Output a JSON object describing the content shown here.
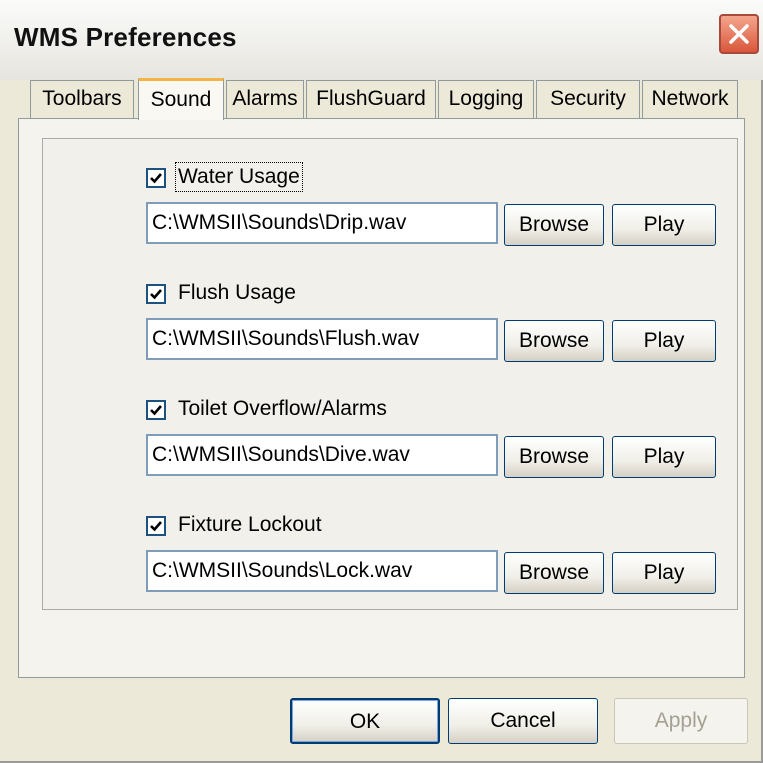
{
  "window": {
    "title": "WMS Preferences"
  },
  "tabs": [
    {
      "label": "Toolbars"
    },
    {
      "label": "Sound",
      "active": true
    },
    {
      "label": "Alarms"
    },
    {
      "label": "FlushGuard"
    },
    {
      "label": "Logging"
    },
    {
      "label": "Security"
    },
    {
      "label": "Network"
    }
  ],
  "sounds": [
    {
      "label": "Water Usage",
      "checked": true,
      "path": "C:\\WMSII\\Sounds\\Drip.wav",
      "browse": "Browse",
      "play": "Play"
    },
    {
      "label": "Flush Usage",
      "checked": true,
      "path": "C:\\WMSII\\Sounds\\Flush.wav",
      "browse": "Browse",
      "play": "Play"
    },
    {
      "label": "Toilet Overflow/Alarms",
      "checked": true,
      "path": "C:\\WMSII\\Sounds\\Dive.wav",
      "browse": "Browse",
      "play": "Play"
    },
    {
      "label": "Fixture Lockout",
      "checked": true,
      "path": "C:\\WMSII\\Sounds\\Lock.wav",
      "browse": "Browse",
      "play": "Play"
    }
  ],
  "footer": {
    "ok": "OK",
    "cancel": "Cancel",
    "apply": "Apply"
  },
  "colors": {
    "active_tab_accent": "#f5b345",
    "close_button": "#d9573b",
    "dialog_background": "#ece9d8"
  }
}
